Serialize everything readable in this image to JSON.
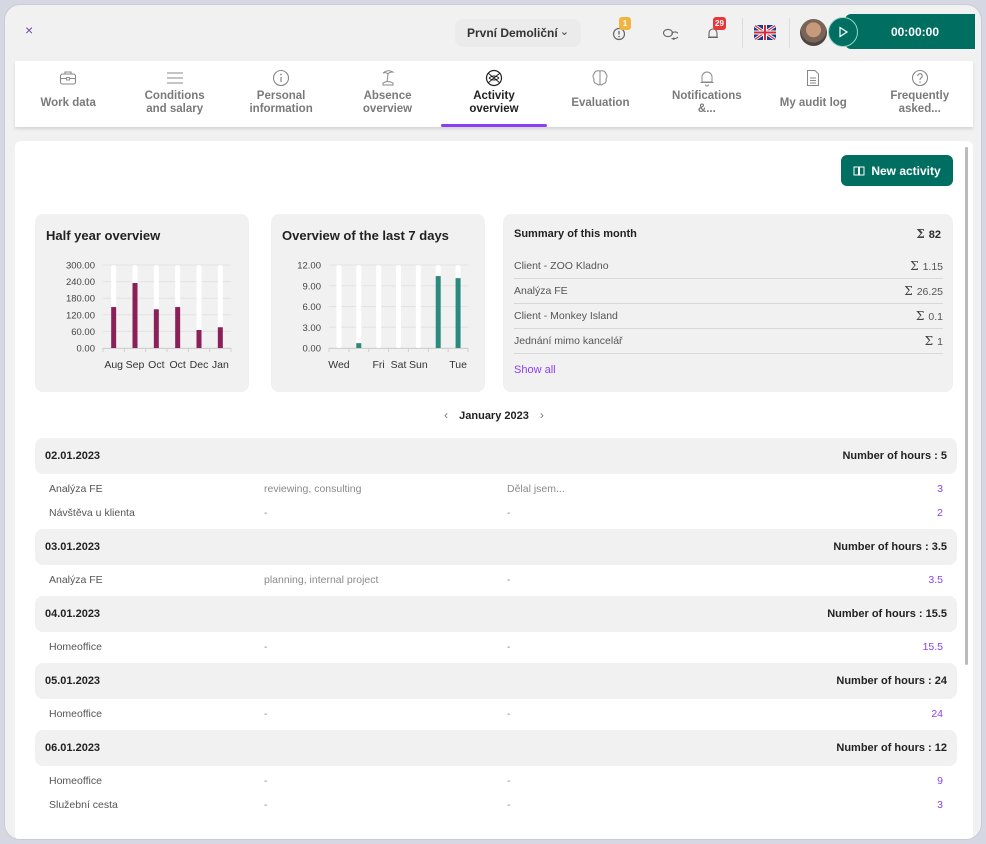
{
  "header": {
    "close_label": "×",
    "company": "První Demoliční",
    "alerts_badge": "1",
    "notifications_badge": "29",
    "timer": "00:00:00",
    "language": "English (UK)"
  },
  "tabs": [
    {
      "label": "Work data",
      "icon": "briefcase-icon",
      "active": false
    },
    {
      "label": "Conditions and salary",
      "icon": "menu-lines-icon",
      "active": false
    },
    {
      "label": "Personal information",
      "icon": "info-icon",
      "active": false
    },
    {
      "label": "Absence overview",
      "icon": "beach-icon",
      "active": false
    },
    {
      "label": "Activity overview",
      "icon": "basketball-icon",
      "active": true
    },
    {
      "label": "Evaluation",
      "icon": "brain-icon",
      "active": false
    },
    {
      "label": "Notifications &...",
      "icon": "bell-icon",
      "active": false
    },
    {
      "label": "My audit log",
      "icon": "document-icon",
      "active": false
    },
    {
      "label": "Frequently asked...",
      "icon": "question-icon",
      "active": false
    }
  ],
  "toolbar": {
    "new_activity_label": "New activity"
  },
  "colors": {
    "accent": "#8a3ff2",
    "brand": "#006e61",
    "half_year_bar": "#8a2057",
    "week_bar": "#2b8a7e"
  },
  "chart_data": [
    {
      "type": "bar",
      "title": "Half year overview",
      "categories": [
        "Aug",
        "Sep",
        "Oct",
        "Oct",
        "Dec",
        "Jan"
      ],
      "values": [
        148,
        235,
        140,
        148,
        65,
        75
      ],
      "ylim": [
        0,
        300
      ],
      "yticks": [
        "0.00",
        "60.00",
        "120.00",
        "180.00",
        "240.00",
        "300.00"
      ],
      "xlabel": "",
      "ylabel": "",
      "grid": true
    },
    {
      "type": "bar",
      "title": "Overview of the last 7 days",
      "categories": [
        "Wed",
        "",
        "Fri",
        "Sat",
        "Sun",
        "",
        "Tue"
      ],
      "values": [
        0,
        0.7,
        0,
        0,
        0,
        10.4,
        10.1
      ],
      "ylim": [
        0,
        12
      ],
      "yticks": [
        "0.00",
        "3.00",
        "6.00",
        "9.00",
        "12.00"
      ],
      "xlabel": "",
      "ylabel": "",
      "grid": true
    }
  ],
  "summary": {
    "title": "Summary of this month",
    "total": "82",
    "rows": [
      {
        "name": "Client - ZOO Kladno",
        "value": "1.15"
      },
      {
        "name": "Analýza FE",
        "value": "26.25"
      },
      {
        "name": "Client - Monkey Island",
        "value": "0.1"
      },
      {
        "name": "Jednání mimo kancelář",
        "value": "1"
      }
    ],
    "show_all": "Show all"
  },
  "month_nav": {
    "label": "January 2023",
    "prev": "‹",
    "next": "›"
  },
  "days": [
    {
      "date": "02.01.2023",
      "hours_label": "Number of hours : 5",
      "entries": [
        {
          "activity": "Analýza FE",
          "tags": "reviewing, consulting",
          "note": "Dělal jsem...",
          "hours": "3"
        },
        {
          "activity": "Návštěva u klienta",
          "tags": "-",
          "note": "-",
          "hours": "2"
        }
      ]
    },
    {
      "date": "03.01.2023",
      "hours_label": "Number of hours : 3.5",
      "entries": [
        {
          "activity": "Analýza FE",
          "tags": "planning, internal project",
          "note": "-",
          "hours": "3.5"
        }
      ]
    },
    {
      "date": "04.01.2023",
      "hours_label": "Number of hours : 15.5",
      "entries": [
        {
          "activity": "Homeoffice",
          "tags": "-",
          "note": "-",
          "hours": "15.5"
        }
      ]
    },
    {
      "date": "05.01.2023",
      "hours_label": "Number of hours : 24",
      "entries": [
        {
          "activity": "Homeoffice",
          "tags": "-",
          "note": "-",
          "hours": "24"
        }
      ]
    },
    {
      "date": "06.01.2023",
      "hours_label": "Number of hours : 12",
      "entries": [
        {
          "activity": "Homeoffice",
          "tags": "-",
          "note": "-",
          "hours": "9"
        },
        {
          "activity": "Služební cesta",
          "tags": "-",
          "note": "-",
          "hours": "3"
        }
      ]
    }
  ]
}
